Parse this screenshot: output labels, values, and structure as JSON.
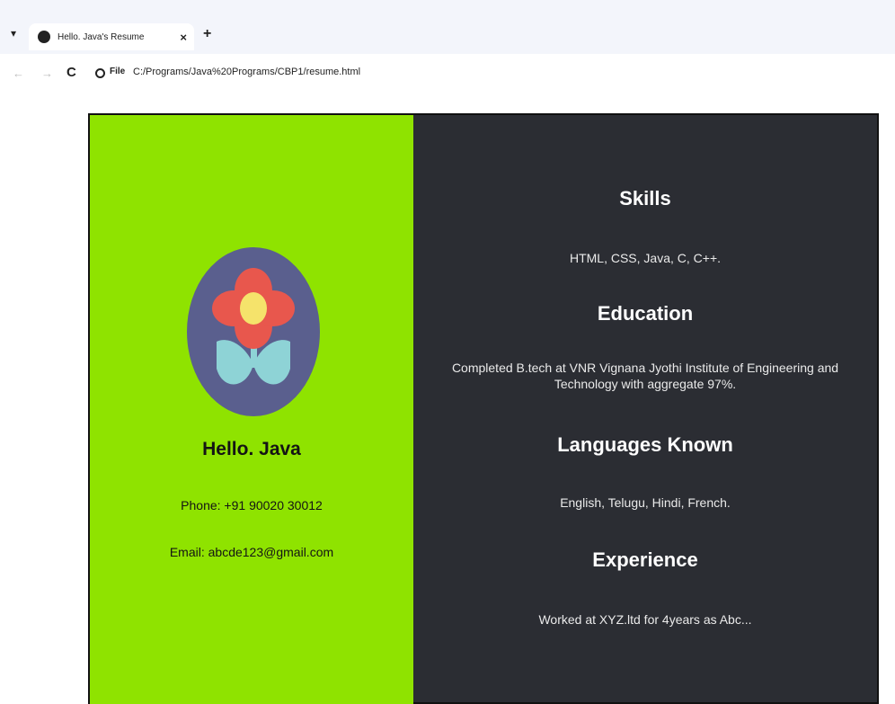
{
  "browser": {
    "tab_title": "Hello. Java's Resume",
    "tab_dropdown_icon": "chevron-down-icon",
    "tab_close_glyph": "×",
    "new_tab_glyph": "+",
    "back_glyph": "←",
    "forward_glyph": "→",
    "reload_glyph": "C",
    "scheme_label": "File",
    "url": "C:/Programs/Java%20Programs/CBP1/resume.html"
  },
  "profile": {
    "name": "Hello. Java",
    "phone": "Phone: +91 90020 30012",
    "email": "Email: abcde123@gmail.com",
    "avatar_icon": "flower-icon"
  },
  "sections": {
    "skills": {
      "heading": "Skills",
      "body": "HTML, CSS, Java, C, C++."
    },
    "education": {
      "heading": "Education",
      "body": "Completed B.tech at VNR Vignana Jyothi Institute of Engineering and Technology with aggregate 97%."
    },
    "languages": {
      "heading": "Languages Known",
      "body": "English, Telugu, Hindi, French."
    },
    "experience": {
      "heading": "Experience",
      "body": "Worked at XYZ.ltd for 4years as Abc..."
    }
  },
  "colors": {
    "left_panel": "#8fe300",
    "right_panel": "#2b2d33",
    "avatar_bg": "#5a5f8e",
    "petal": "#e8574d",
    "center": "#f5e36b",
    "leaf": "#8ed3d6"
  }
}
